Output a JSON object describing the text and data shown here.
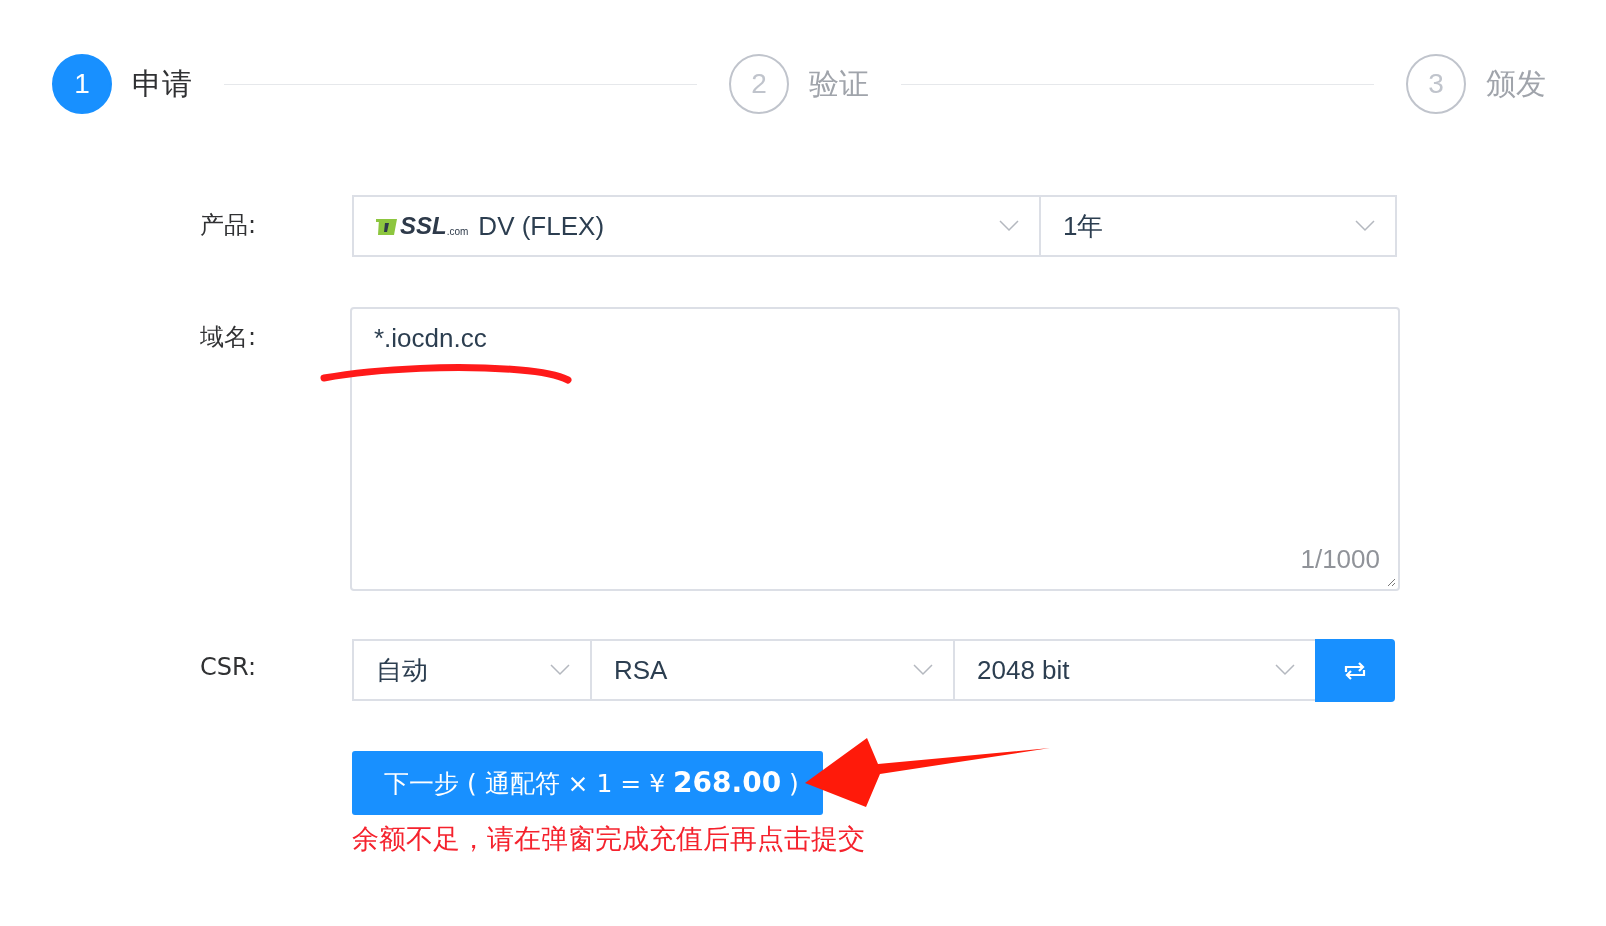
{
  "steps": [
    {
      "number": "1",
      "label": "申请",
      "active": true
    },
    {
      "number": "2",
      "label": "验证",
      "active": false
    },
    {
      "number": "3",
      "label": "颁发",
      "active": false
    }
  ],
  "form": {
    "product": {
      "label": "产品:",
      "logo": {
        "mark": "SSL",
        "suffix": ".com"
      },
      "name": "DV (FLEX)",
      "period": "1年"
    },
    "domain": {
      "label": "域名:",
      "value": "*.iocdn.cc",
      "counter": "1/1000"
    },
    "csr": {
      "label": "CSR:",
      "selects": [
        "自动",
        "RSA",
        "2048 bit"
      ]
    },
    "submit": {
      "text": "下一步 ( 通配符 × 1 = ¥ ",
      "price": "268.00",
      "close": " )"
    },
    "error": "余额不足，请在弹窗完成充值后再点击提交"
  }
}
